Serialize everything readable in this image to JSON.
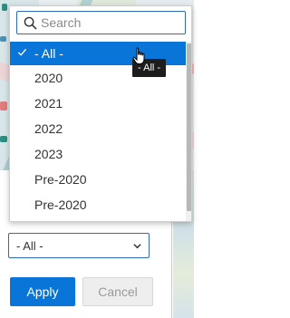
{
  "dropdown": {
    "search": {
      "placeholder": "Search",
      "value": ""
    },
    "options": [
      {
        "label": "- All -",
        "selected": true
      },
      {
        "label": "2020",
        "selected": false
      },
      {
        "label": "2021",
        "selected": false
      },
      {
        "label": "2022",
        "selected": false
      },
      {
        "label": "2023",
        "selected": false
      },
      {
        "label": "Pre-2020",
        "selected": false
      },
      {
        "label": "Pre-2020",
        "selected": false
      }
    ],
    "tooltip": "- All -"
  },
  "filter": {
    "select_value": "- All -"
  },
  "actions": {
    "apply_label": "Apply",
    "cancel_label": "Cancel"
  },
  "colors": {
    "accent": "#0a75d8",
    "border_focus": "#2e6db4",
    "disabled_bg": "#eeeeee"
  },
  "icons": {
    "search": "search-icon",
    "check": "check-icon",
    "chevron": "chevron-down-icon",
    "cursor": "hand-pointer-icon"
  }
}
